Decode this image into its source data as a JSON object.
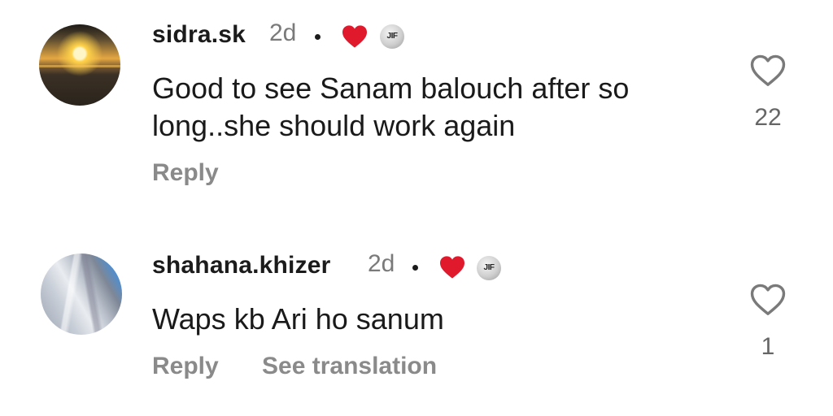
{
  "comments": [
    {
      "username": "sidra.sk",
      "time": "2d",
      "badge_text": "JIF",
      "text": "Good to see Sanam balouch after so long..she should work again",
      "reply_label": "Reply",
      "like_count": "22",
      "avatar_icon": "sunset-avatar",
      "heart_color": "#e0192d"
    },
    {
      "username": "shahana.khizer",
      "time": "2d",
      "badge_text": "JIF",
      "text": "Waps kb Ari ho sanum",
      "reply_label": "Reply",
      "see_translation_label": "See translation",
      "like_count": "1",
      "avatar_icon": "fabric-avatar",
      "heart_color": "#e0192d"
    }
  ]
}
